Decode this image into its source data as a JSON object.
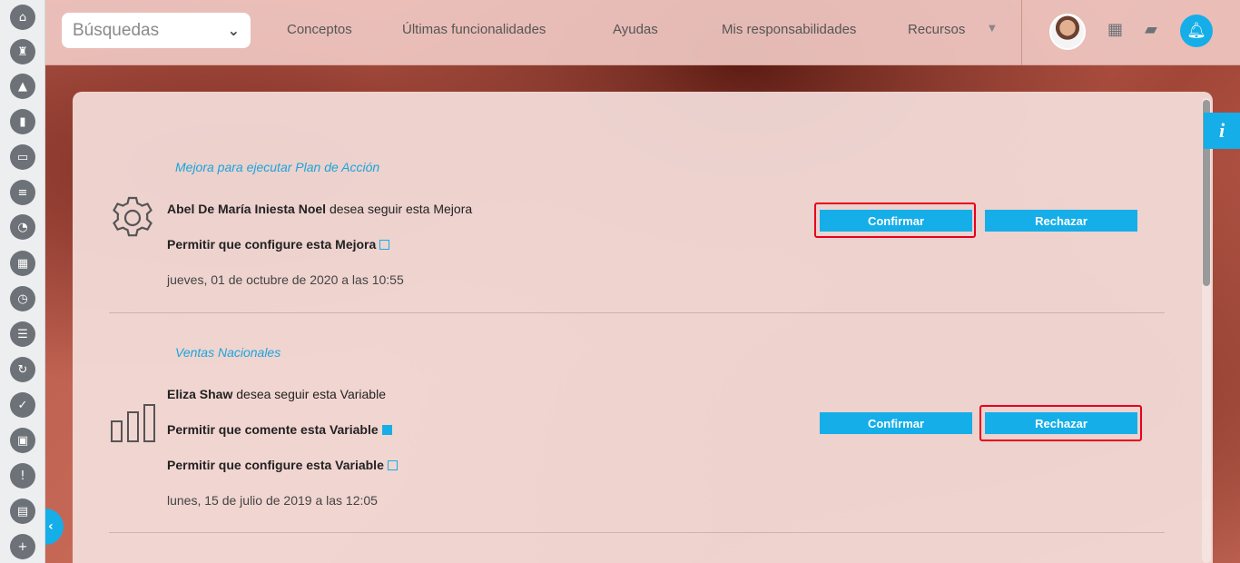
{
  "sidebar": {
    "icons": [
      "home-icon",
      "tower-icon",
      "cone-icon",
      "bar-chart-icon",
      "presentation-icon",
      "list-icon",
      "pie-chart-icon",
      "map-icon",
      "clock-icon",
      "document-icon",
      "cycle-icon",
      "check-icon",
      "briefcase-icon",
      "warning-icon",
      "calendar-icon",
      "plus-icon"
    ]
  },
  "topbar": {
    "search_label": "Búsquedas",
    "nav": [
      "Conceptos",
      "Últimas funcionalidades",
      "Ayudas",
      "Mis responsabilidades",
      "Recursos"
    ]
  },
  "notifications": [
    {
      "title": "Mejora para ejecutar Plan de Acción",
      "user": "Abel De María Iniesta Noel",
      "action": "desea seguir esta Mejora",
      "permissions": [
        {
          "label": "Permitir que configure esta Mejora",
          "checked": false
        }
      ],
      "date": "jueves, 01 de octubre de 2020 a las 10:55",
      "confirm_label": "Confirmar",
      "reject_label": "Rechazar"
    },
    {
      "title": "Ventas Nacionales",
      "user": "Eliza Shaw",
      "action": "desea seguir esta Variable",
      "permissions": [
        {
          "label": "Permitir que comente esta Variable",
          "checked": true
        },
        {
          "label": "Permitir que configure esta Variable",
          "checked": false
        }
      ],
      "date": "lunes, 15 de julio de 2019 a las 12:05",
      "confirm_label": "Confirmar",
      "reject_label": "Rechazar"
    }
  ],
  "colors": {
    "accent": "#15aee8",
    "highlight": "#e8001c"
  }
}
